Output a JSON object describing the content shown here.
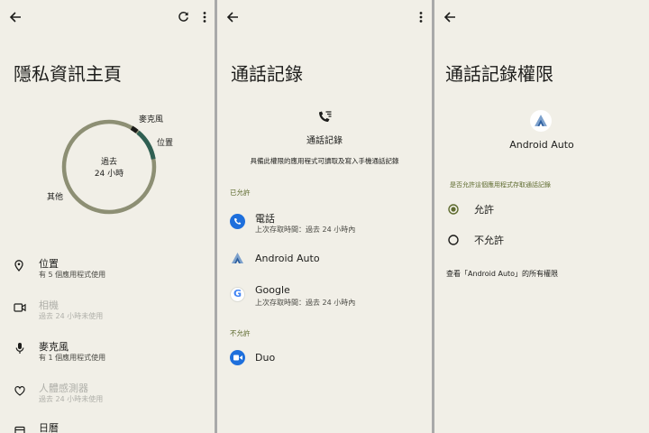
{
  "colors": {
    "background": "#f1efe7",
    "ring_main": "#8d8f74",
    "ring_location": "#2f5f52",
    "ring_mic": "#1b1b18",
    "accent": "#5e6b2f",
    "phone_blue": "#1e6fdc"
  },
  "dashboard": {
    "title": "隱私資訊主頁",
    "center_line1": "過去",
    "center_line2": "24 小時",
    "ring_labels": {
      "microphone": "麥克風",
      "location": "位置",
      "other": "其他"
    },
    "items": [
      {
        "icon": "location-pin-icon",
        "label": "位置",
        "sub": "有 5 個應用程式使用",
        "active": true
      },
      {
        "icon": "camera-icon",
        "label": "相機",
        "sub": "過去 24 小時未使用",
        "active": false
      },
      {
        "icon": "microphone-icon",
        "label": "麥克風",
        "sub": "有 1 個應用程式使用",
        "active": true
      },
      {
        "icon": "heart-icon",
        "label": "人體感測器",
        "sub": "過去 24 小時未使用",
        "active": false
      },
      {
        "icon": "calendar-icon",
        "label": "日曆",
        "sub": "",
        "active": true
      }
    ]
  },
  "calllog": {
    "title": "通話記錄",
    "header_label": "通話記錄",
    "description": "具備此權限的應用程式可讀取及寫入手機通話記錄",
    "allowed_header": "已允許",
    "denied_header": "不允許",
    "allowed": [
      {
        "name": "電話",
        "sub": "上次存取時間：過去 24 小時內",
        "icon": "phone-app-icon"
      },
      {
        "name": "Android Auto",
        "sub": "",
        "icon": "android-auto-icon"
      },
      {
        "name": "Google",
        "sub": "上次存取時間：過去 24 小時內",
        "icon": "google-icon"
      }
    ],
    "denied": [
      {
        "name": "Duo",
        "sub": "",
        "icon": "duo-icon"
      }
    ]
  },
  "permission": {
    "title": "通話記錄權限",
    "app_name": "Android Auto",
    "question": "是否允許這個應用程式存取通話記錄",
    "options": [
      {
        "label": "允許",
        "selected": true
      },
      {
        "label": "不允許",
        "selected": false
      }
    ],
    "footer_link": "查看「Android Auto」的所有權限"
  }
}
